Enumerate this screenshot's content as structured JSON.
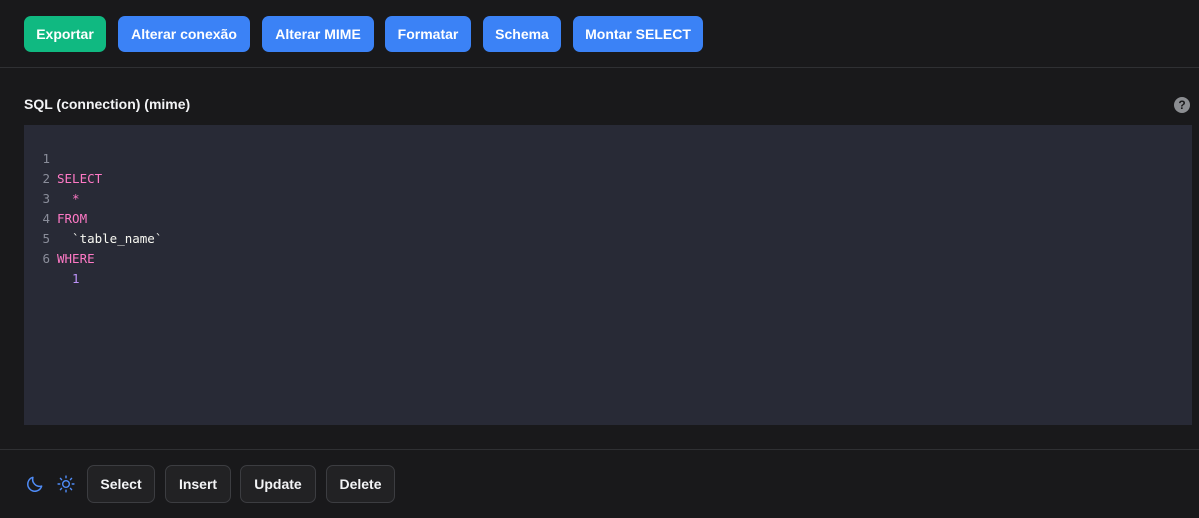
{
  "toolbar": {
    "buttons": [
      {
        "label": "Exportar",
        "color": "#10b981"
      },
      {
        "label": "Alterar conexão",
        "color": "#3b82f6"
      },
      {
        "label": "Alterar MIME",
        "color": "#3b82f6"
      },
      {
        "label": "Formatar",
        "color": "#3b82f6"
      },
      {
        "label": "Schema",
        "color": "#3b82f6"
      },
      {
        "label": "Montar SELECT",
        "color": "#3b82f6"
      }
    ]
  },
  "editor": {
    "label": "SQL (connection) (mime)",
    "help_icon": "question-circle-icon",
    "help_glyph": "?",
    "lines": [
      {
        "number": "1",
        "text": "SELECT"
      },
      {
        "number": "2",
        "text": "  *"
      },
      {
        "number": "3",
        "text": "FROM"
      },
      {
        "number": "4",
        "text": "  `table_name`"
      },
      {
        "number": "5",
        "text": "WHERE"
      },
      {
        "number": "6",
        "text": "  1"
      }
    ],
    "colors": {
      "background": "#282a36",
      "keyword": "#ff79c6",
      "identifier": "#f8f8f2",
      "number": "#bd93f9",
      "line_number": "#8a8d9a"
    }
  },
  "footer": {
    "theme_icons": [
      "moon-icon",
      "sun-icon"
    ],
    "buttons": [
      {
        "label": "Select"
      },
      {
        "label": "Insert"
      },
      {
        "label": "Update"
      },
      {
        "label": "Delete"
      }
    ]
  },
  "colors": {
    "page_background": "#19191b",
    "accent_blue": "#3b82f6",
    "accent_green": "#10b981"
  }
}
